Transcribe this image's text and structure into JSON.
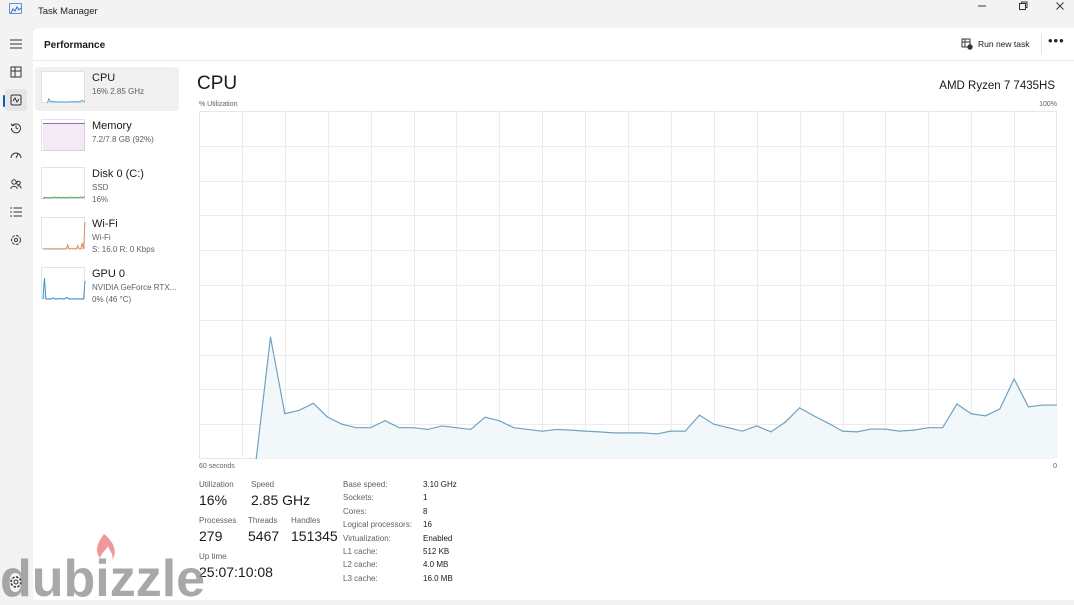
{
  "window": {
    "title": "Task Manager",
    "controls": [
      "minimize",
      "restore",
      "close"
    ]
  },
  "nav": {
    "items": [
      {
        "name": "hamburger-menu",
        "icon": "menu-icon"
      },
      {
        "name": "processes",
        "icon": "processes-icon"
      },
      {
        "name": "performance",
        "icon": "performance-icon",
        "active": true
      },
      {
        "name": "app-history",
        "icon": "history-icon"
      },
      {
        "name": "startup-apps",
        "icon": "startup-icon"
      },
      {
        "name": "users",
        "icon": "users-icon"
      },
      {
        "name": "details",
        "icon": "details-icon"
      },
      {
        "name": "services",
        "icon": "services-icon"
      }
    ],
    "settings_icon": "gear-icon"
  },
  "header": {
    "title": "Performance",
    "run_new_task": "Run new task",
    "more": "•••"
  },
  "sidebar": {
    "items": [
      {
        "name": "CPU",
        "line1": "16% 2.85 GHz",
        "line2": "",
        "color": "#4f9fd0",
        "active": true
      },
      {
        "name": "Memory",
        "line1": "7.2/7.8 GB (92%)",
        "line2": "",
        "color": "#9b4fb0"
      },
      {
        "name": "Disk 0 (C:)",
        "line1": "SSD",
        "line2": "16%",
        "color": "#4fa84f"
      },
      {
        "name": "Wi-Fi",
        "line1": "Wi-Fi",
        "line2": "S: 16.0 R: 0 Kbps",
        "color": "#d9875a"
      },
      {
        "name": "GPU 0",
        "line1": "NVIDIA GeForce RTX...",
        "line2": "0% (46 °C)",
        "color": "#2f8fd0"
      }
    ]
  },
  "cpu": {
    "title": "CPU",
    "model": "AMD Ryzen 7 7435HS",
    "y_label": "% Utilization",
    "y_max_label": "100%",
    "x_left_label": "60 seconds",
    "x_right_label": "0"
  },
  "chart_data": {
    "type": "area",
    "title": "CPU",
    "ylabel": "% Utilization",
    "xlabel": "60 seconds",
    "ylim": [
      0,
      100
    ],
    "xlim": [
      60,
      0
    ],
    "grid": true,
    "grid_cols": 20,
    "grid_rows": 10,
    "line_color": "#6fa3c2",
    "fill_color": "#f1f6fa",
    "series": [
      {
        "name": "CPU utilization",
        "values": [
          null,
          null,
          null,
          null,
          0,
          35,
          13,
          14,
          16,
          12,
          10,
          9,
          9,
          11,
          9,
          9,
          8.5,
          9.5,
          9,
          8.5,
          12,
          11,
          9,
          8.5,
          8,
          8.5,
          8.3,
          8,
          7.8,
          7.5,
          7.5,
          7.5,
          7.2,
          8,
          8,
          12.6,
          10,
          9,
          8,
          9.5,
          7.8,
          10.6,
          14.7,
          12.4,
          10.3,
          8,
          7.8,
          8.6,
          8.6,
          8,
          8.3,
          9,
          9,
          15.8,
          13,
          12.4,
          14.4,
          23,
          15,
          15.5,
          15.5
        ]
      }
    ]
  },
  "stats": {
    "utilization_label": "Utilization",
    "utilization": "16%",
    "speed_label": "Speed",
    "speed": "2.85 GHz",
    "processes_label": "Processes",
    "processes": "279",
    "threads_label": "Threads",
    "threads": "5467",
    "handles_label": "Handles",
    "handles": "151345",
    "uptime_label": "Up time",
    "uptime": "25:07:10:08"
  },
  "specs": [
    {
      "label": "Base speed:",
      "value": "3.10 GHz"
    },
    {
      "label": "Sockets:",
      "value": "1"
    },
    {
      "label": "Cores:",
      "value": "8"
    },
    {
      "label": "Logical processors:",
      "value": "16"
    },
    {
      "label": "Virtualization:",
      "value": "Enabled"
    },
    {
      "label": "L1 cache:",
      "value": "512 KB"
    },
    {
      "label": "L2 cache:",
      "value": "4.0 MB"
    },
    {
      "label": "L3 cache:",
      "value": "16.0 MB"
    }
  ],
  "watermark": {
    "text": "dubizzle"
  }
}
